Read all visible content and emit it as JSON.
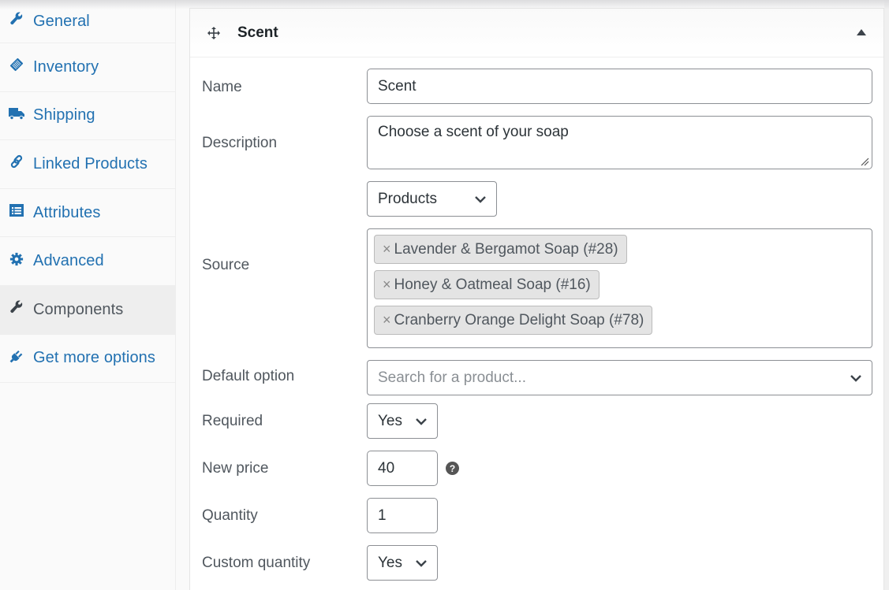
{
  "sidebar": {
    "items": [
      {
        "label": "General",
        "icon": "wrench-icon",
        "active": false
      },
      {
        "label": "Inventory",
        "icon": "tag-icon",
        "active": false
      },
      {
        "label": "Shipping",
        "icon": "truck-icon",
        "active": false
      },
      {
        "label": "Linked Products",
        "icon": "link-icon",
        "active": false
      },
      {
        "label": "Attributes",
        "icon": "list-icon",
        "active": false
      },
      {
        "label": "Advanced",
        "icon": "gear-icon",
        "active": false
      },
      {
        "label": "Components",
        "icon": "wrench-icon",
        "active": true
      },
      {
        "label": "Get more options",
        "icon": "plug-icon",
        "active": false
      }
    ]
  },
  "panel": {
    "title": "Scent",
    "fields": {
      "name": {
        "label": "Name",
        "value": "Scent"
      },
      "description": {
        "label": "Description",
        "value": "Choose a scent of your soap"
      },
      "source": {
        "label": "Source",
        "type_select": "Products",
        "selected": [
          "Lavender & Bergamot Soap (#28)",
          "Honey & Oatmeal Soap (#16)",
          "Cranberry Orange Delight Soap (#78)"
        ]
      },
      "default_option": {
        "label": "Default option",
        "placeholder": "Search for a product..."
      },
      "required": {
        "label": "Required",
        "value": "Yes"
      },
      "new_price": {
        "label": "New price",
        "value": "40",
        "help": "?"
      },
      "quantity": {
        "label": "Quantity",
        "value": "1"
      },
      "custom_quantity": {
        "label": "Custom quantity",
        "value": "Yes"
      }
    }
  },
  "colors": {
    "link": "#2271b1",
    "active_bg": "#eeeeee",
    "tag_bg": "#e4e4e4"
  }
}
